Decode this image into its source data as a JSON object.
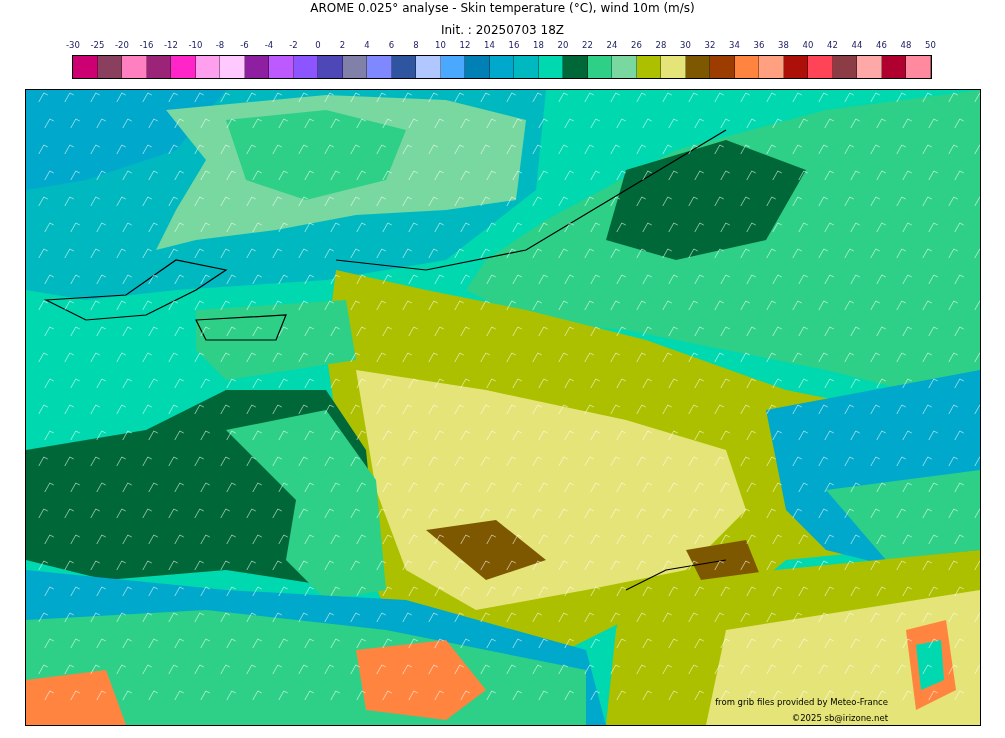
{
  "title": "AROME 0.025° analyse - Skin temperature (°C), wind 10m (m/s)",
  "subtitle": "Init. : 20250703 18Z",
  "colorbar": {
    "ticks": [
      "-30",
      "-25",
      "-20",
      "-16",
      "-12",
      "-10",
      "-8",
      "-6",
      "-4",
      "-2",
      "0",
      "2",
      "4",
      "6",
      "8",
      "10",
      "12",
      "14",
      "16",
      "18",
      "20",
      "22",
      "24",
      "26",
      "28",
      "30",
      "32",
      "34",
      "36",
      "38",
      "40",
      "42",
      "44",
      "46",
      "48",
      "50"
    ],
    "bins": [
      {
        "color": "#cc0073"
      },
      {
        "color": "#8b3f5f"
      },
      {
        "color": "#ff80c0"
      },
      {
        "color": "#9b2478"
      },
      {
        "color": "#ff25c8"
      },
      {
        "color": "#ffa0ee"
      },
      {
        "color": "#ffc8ff"
      },
      {
        "color": "#8e1fa0"
      },
      {
        "color": "#bc5aff"
      },
      {
        "color": "#8c55ff"
      },
      {
        "color": "#4e47b8"
      },
      {
        "color": "#8080a8"
      },
      {
        "color": "#8088ff"
      },
      {
        "color": "#2f55a0"
      },
      {
        "color": "#b0c8ff"
      },
      {
        "color": "#4ba8ff"
      },
      {
        "color": "#0080b4"
      },
      {
        "color": "#00a8cc"
      },
      {
        "color": "#00b8c0"
      },
      {
        "color": "#00d8b0"
      },
      {
        "color": "#006838"
      },
      {
        "color": "#2ed088"
      },
      {
        "color": "#78d8a0"
      },
      {
        "color": "#acc000"
      },
      {
        "color": "#e4e478"
      },
      {
        "color": "#7e5800"
      },
      {
        "color": "#9c3c00"
      },
      {
        "color": "#ff8440"
      },
      {
        "color": "#ffa080"
      },
      {
        "color": "#ac1008"
      },
      {
        "color": "#ff4458"
      },
      {
        "color": "#8c3c44"
      },
      {
        "color": "#ffa8a8"
      },
      {
        "color": "#b00030"
      },
      {
        "color": "#ff8aa0"
      }
    ]
  },
  "credits": [
    "from grib files provided by Meteo-France",
    "©2025 sb@irizone.net"
  ]
}
